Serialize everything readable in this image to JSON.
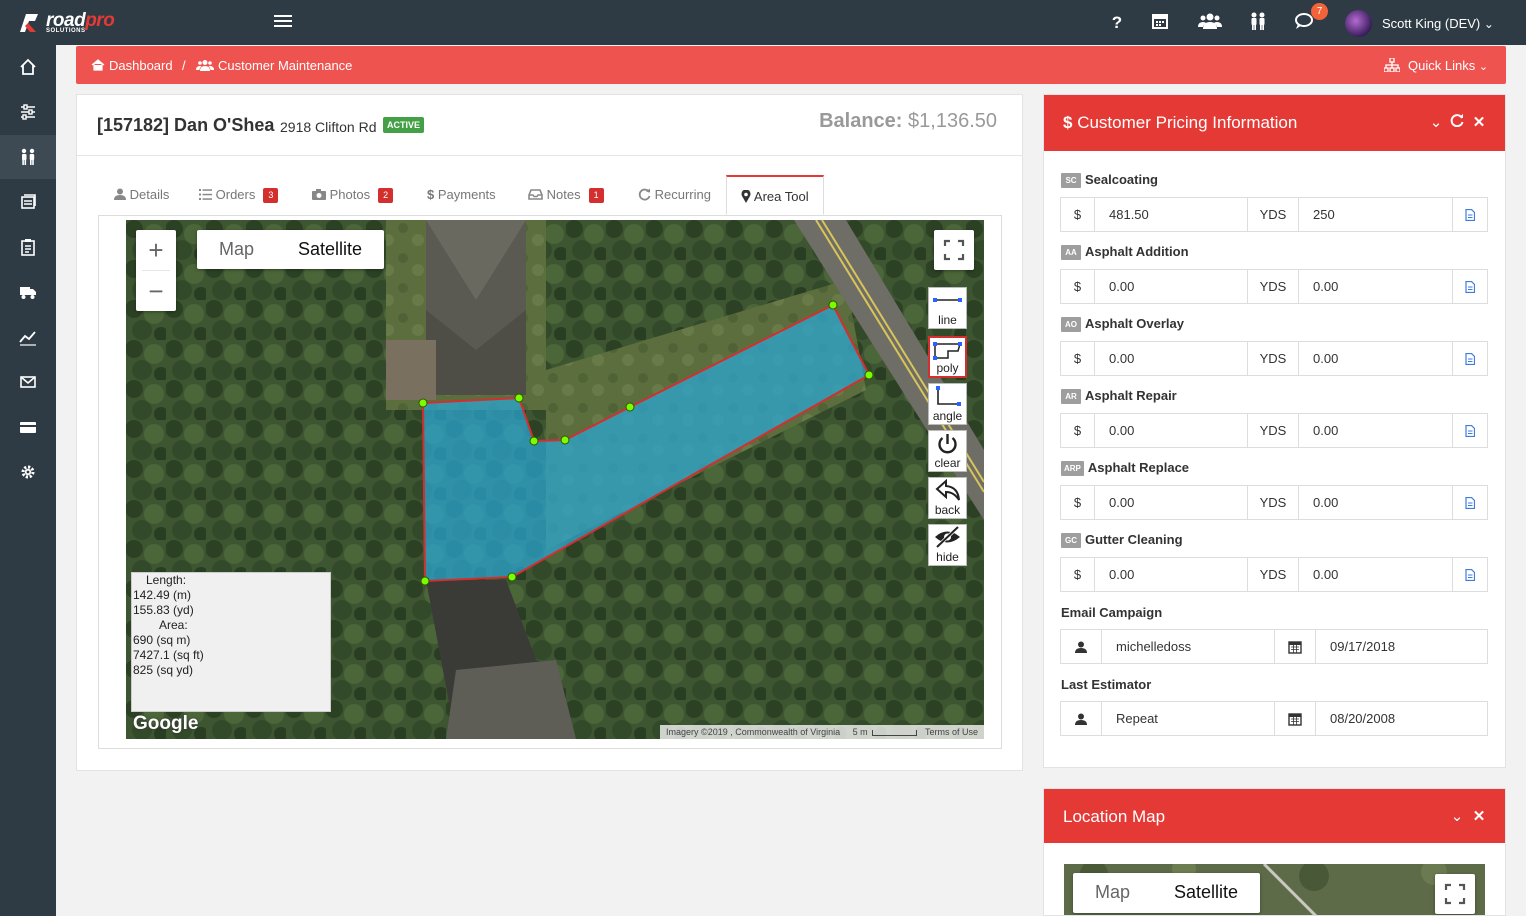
{
  "brand": {
    "name_main": "road",
    "name_accent": "pro",
    "subtitle": "SOLUTIONS"
  },
  "topbar": {
    "icons": [
      "help-icon",
      "calendar-icon",
      "users-icon",
      "customers-icon",
      "chat-icon"
    ],
    "help_glyph": "?",
    "chat_badge": "7",
    "user_name": "Scott King (DEV)",
    "user_caret": "⌄"
  },
  "sidebar": {
    "items": [
      {
        "name": "home"
      },
      {
        "name": "settings-sliders"
      },
      {
        "name": "customers",
        "active": true
      },
      {
        "name": "billing"
      },
      {
        "name": "clipboard"
      },
      {
        "name": "truck"
      },
      {
        "name": "analytics"
      },
      {
        "name": "mail"
      },
      {
        "name": "payment-card"
      },
      {
        "name": "gear"
      }
    ]
  },
  "breadcrumb": {
    "home": "Dashboard",
    "separator": "/",
    "current": "Customer Maintenance",
    "quick_links": "Quick Links"
  },
  "customer": {
    "title": "[157182] Dan O'Shea",
    "address": "2918 Clifton Rd",
    "status": "ACTIVE",
    "balance_label": "Balance:",
    "balance_value": "$1,136.50"
  },
  "tabs": [
    {
      "label": "Details",
      "count": ""
    },
    {
      "label": "Orders",
      "count": "3"
    },
    {
      "label": "Photos",
      "count": "2"
    },
    {
      "label": "Payments",
      "count": ""
    },
    {
      "label": "Notes",
      "count": "1"
    },
    {
      "label": "Recurring",
      "count": ""
    },
    {
      "label": "Area Tool",
      "count": "",
      "active": true
    }
  ],
  "map": {
    "type_map": "Map",
    "type_satellite": "Satellite",
    "selected_type": "Satellite",
    "zoom_in": "+",
    "zoom_out": "−",
    "tools": [
      {
        "label": "line",
        "icon": "line-tool-icon"
      },
      {
        "label": "poly",
        "icon": "poly-tool-icon",
        "selected": true
      },
      {
        "label": "angle",
        "icon": "angle-tool-icon"
      },
      {
        "label": "clear",
        "icon": "power-icon"
      },
      {
        "label": "back",
        "icon": "undo-icon"
      },
      {
        "label": "hide",
        "icon": "eye-slash-icon"
      }
    ],
    "measurements": {
      "length_label": "Length:",
      "length_m": "142.49 (m)",
      "length_yd": "155.83 (yd)",
      "area_label": "Area:",
      "area_sqm": "690 (sq m)",
      "area_sqft": "7427.1 (sq ft)",
      "area_sqyd": "825 (sq yd)"
    },
    "logo": "Google",
    "attribution": "Imagery ©2019 , Commonwealth of Virginia",
    "scale": "5 m",
    "terms": "Terms of Use",
    "colors": {
      "polygon_fill": "#2aa7d6",
      "polygon_stroke": "#d32f2f",
      "vertex": "#7cfc00"
    }
  },
  "pricing": {
    "title": "Customer Pricing Information",
    "dollar": "$",
    "unit": "YDS",
    "services": [
      {
        "code": "SC",
        "name": "Sealcoating",
        "price": "481.50",
        "qty": "250"
      },
      {
        "code": "AA",
        "name": "Asphalt Addition",
        "price": "0.00",
        "qty": "0.00"
      },
      {
        "code": "AO",
        "name": "Asphalt Overlay",
        "price": "0.00",
        "qty": "0.00"
      },
      {
        "code": "AR",
        "name": "Asphalt Repair",
        "price": "0.00",
        "qty": "0.00"
      },
      {
        "code": "ARP",
        "name": "Asphalt Replace",
        "price": "0.00",
        "qty": "0.00"
      },
      {
        "code": "GC",
        "name": "Gutter Cleaning",
        "price": "0.00",
        "qty": "0.00"
      }
    ],
    "email_campaign": {
      "label": "Email Campaign",
      "user": "michelledoss",
      "date": "09/17/2018"
    },
    "last_estimator": {
      "label": "Last Estimator",
      "user": "Repeat",
      "date": "08/20/2008"
    }
  },
  "location_map": {
    "title": "Location Map",
    "type_map": "Map",
    "type_satellite": "Satellite"
  },
  "colors": {
    "accent": "#e53935",
    "nav": "#2f3b44",
    "success": "#43a047",
    "badge": "#d32f2f"
  }
}
